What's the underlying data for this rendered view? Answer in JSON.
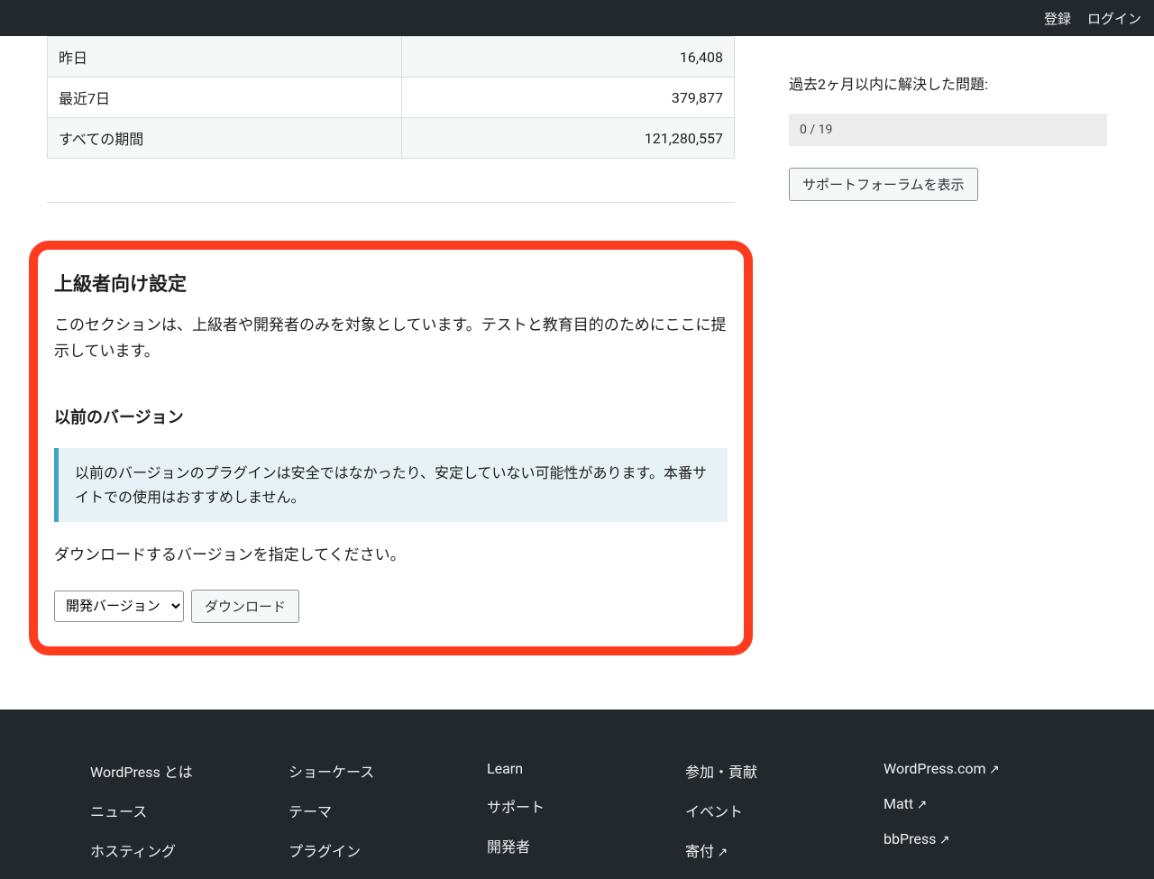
{
  "topbar": {
    "register": "登録",
    "login": "ログイン"
  },
  "stats": {
    "rows": [
      {
        "label": "昨日",
        "value": "16,408"
      },
      {
        "label": "最近7日",
        "value": "379,877"
      },
      {
        "label": "すべての期間",
        "value": "121,280,557"
      }
    ]
  },
  "advanced": {
    "heading": "上級者向け設定",
    "lead": "このセクションは、上級者や開発者のみを対象としています。テストと教育目的のためにここに提示しています。",
    "prev_heading": "以前のバージョン",
    "notice": "以前のバージョンのプラグインは安全ではなかったり、安定していない可能性があります。本番サイトでの使用はおすすめしません。",
    "pick": "ダウンロードするバージョンを指定してください。",
    "version_select": "開発バージョン",
    "download_btn": "ダウンロード"
  },
  "support": {
    "label": "過去2ヶ月以内に解決した問題:",
    "count": "0 / 19",
    "button": "サポートフォーラムを表示"
  },
  "footer": {
    "col1": [
      {
        "text": "WordPress とは",
        "ext": false
      },
      {
        "text": "ニュース",
        "ext": false
      },
      {
        "text": "ホスティング",
        "ext": false
      }
    ],
    "col2": [
      {
        "text": "ショーケース",
        "ext": false
      },
      {
        "text": "テーマ",
        "ext": false
      },
      {
        "text": "プラグイン",
        "ext": false
      }
    ],
    "col3": [
      {
        "text": "Learn",
        "ext": false
      },
      {
        "text": "サポート",
        "ext": false
      },
      {
        "text": "開発者",
        "ext": false
      }
    ],
    "col4": [
      {
        "text": "参加・貢献",
        "ext": false
      },
      {
        "text": "イベント",
        "ext": false
      },
      {
        "text": "寄付",
        "ext": true
      }
    ],
    "col5": [
      {
        "text": "WordPress.com",
        "ext": true
      },
      {
        "text": "Matt",
        "ext": true
      },
      {
        "text": "bbPress",
        "ext": true
      }
    ]
  }
}
